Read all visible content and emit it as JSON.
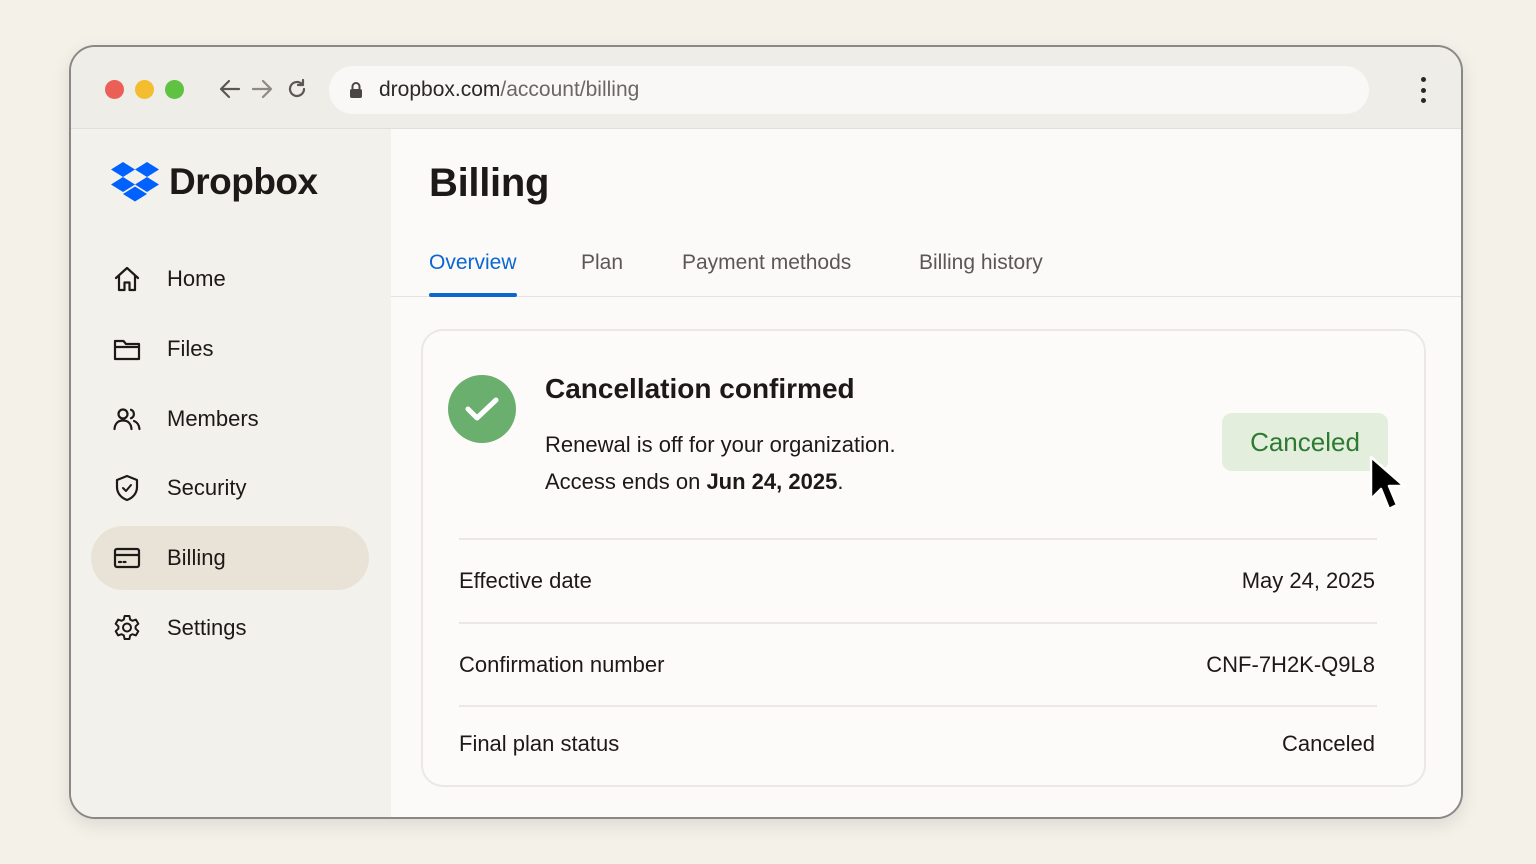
{
  "browser": {
    "url_domain": "dropbox.com",
    "url_path": "/account/billing",
    "icons": [
      "back-arrow-icon",
      "forward-arrow-icon",
      "reload-icon",
      "lock-icon",
      "kebab-menu-icon"
    ]
  },
  "brand": {
    "name": "Dropbox",
    "color": "#0061fe"
  },
  "sidebar": {
    "items": [
      {
        "label": "Home",
        "icon": "home-icon",
        "active": false
      },
      {
        "label": "Files",
        "icon": "folder-icon",
        "active": false
      },
      {
        "label": "Members",
        "icon": "users-icon",
        "active": false
      },
      {
        "label": "Security",
        "icon": "shield-icon",
        "active": false
      },
      {
        "label": "Billing",
        "icon": "credit-card-icon",
        "active": true
      },
      {
        "label": "Settings",
        "icon": "gear-icon",
        "active": false
      }
    ]
  },
  "page": {
    "title": "Billing",
    "tabs": [
      {
        "label": "Overview",
        "active": true
      },
      {
        "label": "Plan",
        "active": false
      },
      {
        "label": "Payment methods",
        "active": false
      },
      {
        "label": "Billing history",
        "active": false
      }
    ]
  },
  "card": {
    "title": "Cancellation confirmed",
    "line1": "Renewal is off for your organization.",
    "line2_prefix": "Access ends on ",
    "line2_date": "Jun 24, 2025",
    "line2_suffix": ".",
    "badge": "Canceled",
    "badge_color": "#2d7a32",
    "success_color": "#6aaf6e",
    "rows": [
      {
        "label": "Effective date",
        "value": "May 24, 2025"
      },
      {
        "label": "Confirmation number",
        "value": "CNF-7H2K-Q9L8"
      },
      {
        "label": "Final plan status",
        "value": "Canceled"
      }
    ]
  },
  "colors": {
    "accent": "#0b67d0"
  }
}
